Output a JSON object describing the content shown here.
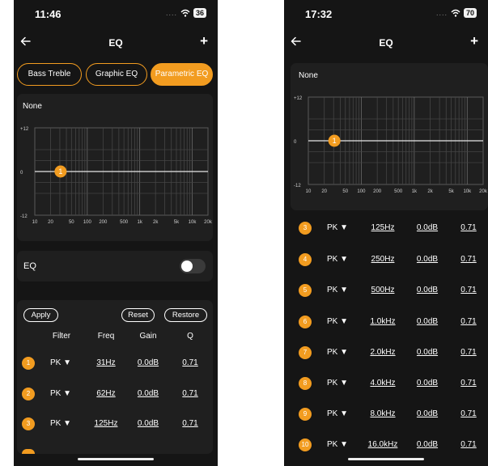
{
  "colors": {
    "accent": "#f29c20",
    "background": "#151515",
    "card": "#1f1f1f"
  },
  "icons": {
    "back": "arrow-left-icon",
    "add": "plus-icon",
    "wifi": "wifi-icon",
    "toggle": "toggle-switch"
  },
  "phone1": {
    "status": {
      "time": "11:46",
      "dots": "....",
      "battery": "36"
    },
    "nav": {
      "title": "EQ",
      "add": "+"
    },
    "tabs": [
      "Bass Treble",
      "Graphic EQ",
      "Parametric EQ"
    ],
    "active_tab": "Parametric EQ",
    "preset": "None",
    "eq_label": "EQ",
    "eq_enabled": false,
    "buttons": {
      "apply": "Apply",
      "reset": "Reset",
      "restore": "Restore"
    },
    "columns": [
      "Filter",
      "Freq",
      "Gain",
      "Q"
    ],
    "rows": [
      {
        "n": "1",
        "filter": "PK ▼",
        "freq": "31Hz",
        "gain": "0.0dB",
        "q": "0.71"
      },
      {
        "n": "2",
        "filter": "PK ▼",
        "freq": "62Hz",
        "gain": "0.0dB",
        "q": "0.71"
      },
      {
        "n": "3",
        "filter": "PK ▼",
        "freq": "125Hz",
        "gain": "0.0dB",
        "q": "0.71"
      }
    ]
  },
  "phone2": {
    "status": {
      "time": "17:32",
      "dots": "....",
      "battery": "70"
    },
    "nav": {
      "title": "EQ",
      "add": "+"
    },
    "preset": "None",
    "rows": [
      {
        "n": "3",
        "filter": "PK ▼",
        "freq": "125Hz",
        "gain": "0.0dB",
        "q": "0.71"
      },
      {
        "n": "4",
        "filter": "PK ▼",
        "freq": "250Hz",
        "gain": "0.0dB",
        "q": "0.71"
      },
      {
        "n": "5",
        "filter": "PK ▼",
        "freq": "500Hz",
        "gain": "0.0dB",
        "q": "0.71"
      },
      {
        "n": "6",
        "filter": "PK ▼",
        "freq": "1.0kHz",
        "gain": "0.0dB",
        "q": "0.71"
      },
      {
        "n": "7",
        "filter": "PK ▼",
        "freq": "2.0kHz",
        "gain": "0.0dB",
        "q": "0.71"
      },
      {
        "n": "8",
        "filter": "PK ▼",
        "freq": "4.0kHz",
        "gain": "0.0dB",
        "q": "0.71"
      },
      {
        "n": "9",
        "filter": "PK ▼",
        "freq": "8.0kHz",
        "gain": "0.0dB",
        "q": "0.71"
      },
      {
        "n": "10",
        "filter": "PK ▼",
        "freq": "16.0kHz",
        "gain": "0.0dB",
        "q": "0.71"
      }
    ]
  },
  "chart_data": [
    {
      "type": "line",
      "title": "",
      "xscale": "log",
      "xlim": [
        10,
        20000
      ],
      "ylim": [
        -12,
        12
      ],
      "xticks": [
        10,
        20,
        50,
        100,
        200,
        500,
        1000,
        2000,
        5000,
        10000,
        20000
      ],
      "xtick_labels": [
        "10",
        "20",
        "50",
        "100",
        "200",
        "500",
        "1k",
        "2k",
        "5k",
        "10k",
        "20k"
      ],
      "ytick_labels": [
        "+12",
        "0",
        "-12"
      ],
      "yticks": [
        12,
        0,
        -12
      ],
      "curve": {
        "x": [
          10,
          20000
        ],
        "y": [
          0,
          0
        ]
      },
      "points": [
        {
          "label": "1",
          "x": 31,
          "y": 0
        }
      ]
    },
    {
      "type": "line",
      "title": "",
      "xscale": "log",
      "xlim": [
        10,
        20000
      ],
      "ylim": [
        -12,
        12
      ],
      "xticks": [
        10,
        20,
        50,
        100,
        200,
        500,
        1000,
        2000,
        5000,
        10000,
        20000
      ],
      "xtick_labels": [
        "10",
        "20",
        "50",
        "100",
        "200",
        "500",
        "1k",
        "2k",
        "5k",
        "10k",
        "20k"
      ],
      "ytick_labels": [
        "+12",
        "0",
        "-12"
      ],
      "yticks": [
        12,
        0,
        -12
      ],
      "curve": {
        "x": [
          10,
          20000
        ],
        "y": [
          0,
          0
        ]
      },
      "points": [
        {
          "label": "1",
          "x": 31,
          "y": 0
        }
      ]
    }
  ]
}
